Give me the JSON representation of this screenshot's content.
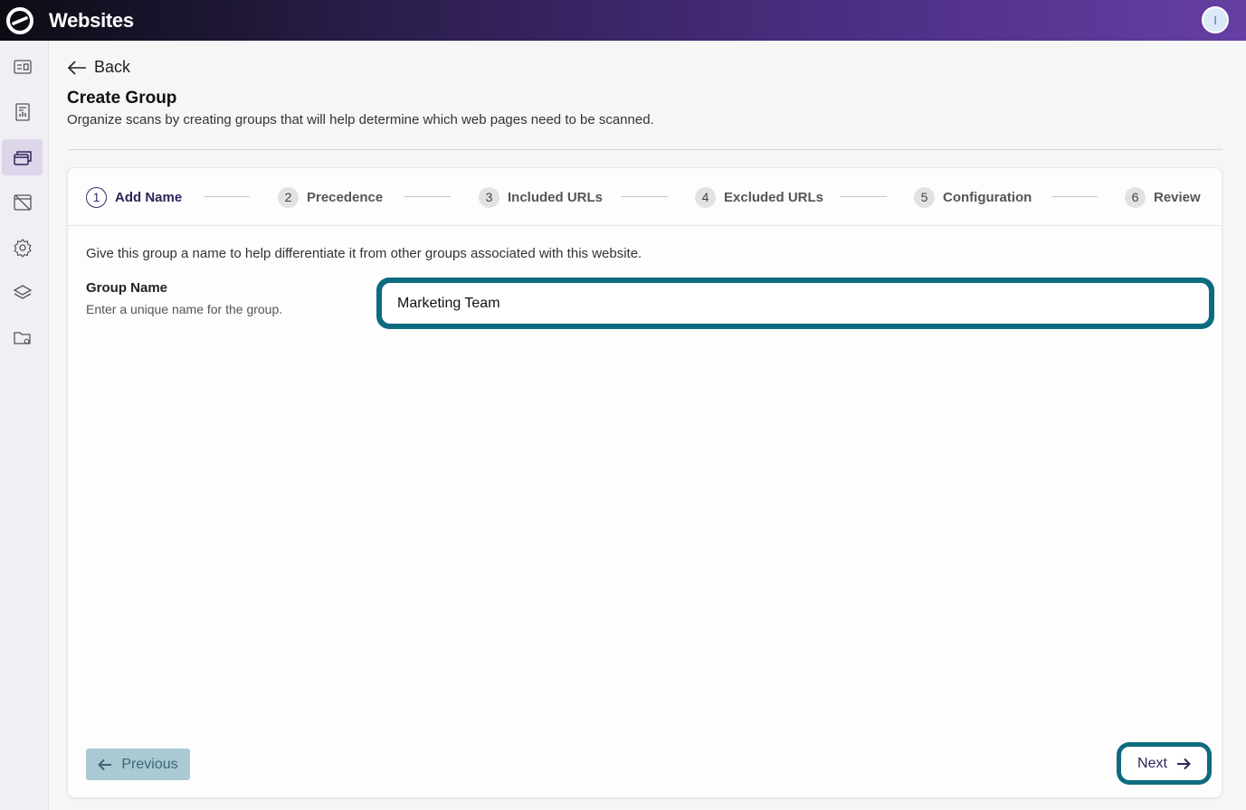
{
  "app": {
    "title": "Websites",
    "avatar_initial": "I"
  },
  "sidebar": {
    "items": [
      {
        "icon": "dashboard-icon",
        "active": false
      },
      {
        "icon": "report-icon",
        "active": false
      },
      {
        "icon": "groups-icon",
        "active": true
      },
      {
        "icon": "hidden-browser-icon",
        "active": false
      },
      {
        "icon": "gear-icon",
        "active": false
      },
      {
        "icon": "layers-icon",
        "active": false
      },
      {
        "icon": "folder-settings-icon",
        "active": false
      }
    ]
  },
  "header": {
    "back_label": "Back",
    "title": "Create Group",
    "subtitle": "Organize scans by creating groups that will help determine which web pages need to be scanned."
  },
  "steps": [
    {
      "num": "1",
      "label": "Add Name",
      "active": true
    },
    {
      "num": "2",
      "label": "Precedence",
      "active": false
    },
    {
      "num": "3",
      "label": "Included URLs",
      "active": false
    },
    {
      "num": "4",
      "label": "Excluded URLs",
      "active": false
    },
    {
      "num": "5",
      "label": "Configuration",
      "active": false
    },
    {
      "num": "6",
      "label": "Review",
      "active": false
    }
  ],
  "form": {
    "instruction": "Give this group a name to help differentiate it from other groups associated with this website.",
    "group_name_label": "Group Name",
    "group_name_help": "Enter a unique name for the group.",
    "group_name_value": "Marketing Team"
  },
  "footer": {
    "previous_label": "Previous",
    "next_label": "Next"
  },
  "colors": {
    "accent": "#0e6b7f",
    "brand_purple": "#653fa3",
    "step_active": "#2e2458"
  }
}
